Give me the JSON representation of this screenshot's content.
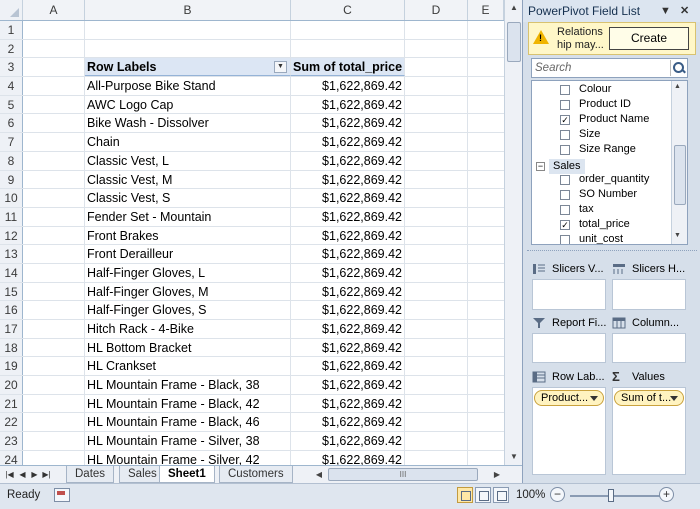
{
  "sheet": {
    "columns": [
      "A",
      "B",
      "C",
      "D",
      "E"
    ],
    "rows": [
      {
        "num": "1",
        "label": "",
        "value": ""
      },
      {
        "num": "2",
        "label": "",
        "value": ""
      },
      {
        "num": "3",
        "label": "Row Labels",
        "value": "Sum of total_price",
        "header": true
      },
      {
        "num": "4",
        "label": "All-Purpose Bike Stand",
        "value": "$1,622,869.42"
      },
      {
        "num": "5",
        "label": "AWC Logo Cap",
        "value": "$1,622,869.42"
      },
      {
        "num": "6",
        "label": "Bike Wash - Dissolver",
        "value": "$1,622,869.42"
      },
      {
        "num": "7",
        "label": "Chain",
        "value": "$1,622,869.42"
      },
      {
        "num": "8",
        "label": "Classic Vest, L",
        "value": "$1,622,869.42"
      },
      {
        "num": "9",
        "label": "Classic Vest, M",
        "value": "$1,622,869.42"
      },
      {
        "num": "10",
        "label": "Classic Vest, S",
        "value": "$1,622,869.42"
      },
      {
        "num": "11",
        "label": "Fender Set - Mountain",
        "value": "$1,622,869.42"
      },
      {
        "num": "12",
        "label": "Front Brakes",
        "value": "$1,622,869.42"
      },
      {
        "num": "13",
        "label": "Front Derailleur",
        "value": "$1,622,869.42"
      },
      {
        "num": "14",
        "label": "Half-Finger Gloves, L",
        "value": "$1,622,869.42"
      },
      {
        "num": "15",
        "label": "Half-Finger Gloves, M",
        "value": "$1,622,869.42"
      },
      {
        "num": "16",
        "label": "Half-Finger Gloves, S",
        "value": "$1,622,869.42"
      },
      {
        "num": "17",
        "label": "Hitch Rack - 4-Bike",
        "value": "$1,622,869.42"
      },
      {
        "num": "18",
        "label": "HL Bottom Bracket",
        "value": "$1,622,869.42"
      },
      {
        "num": "19",
        "label": "HL Crankset",
        "value": "$1,622,869.42"
      },
      {
        "num": "20",
        "label": "HL Mountain Frame - Black, 38",
        "value": "$1,622,869.42"
      },
      {
        "num": "21",
        "label": "HL Mountain Frame - Black, 42",
        "value": "$1,622,869.42"
      },
      {
        "num": "22",
        "label": "HL Mountain Frame - Black, 46",
        "value": "$1,622,869.42"
      },
      {
        "num": "23",
        "label": "HL Mountain Frame - Silver, 38",
        "value": "$1,622,869.42"
      },
      {
        "num": "24",
        "label": "HL Mountain Frame - Silver, 42",
        "value": "$1,622,869.42"
      }
    ],
    "tabs": [
      "Dates",
      "Sales",
      "Sheet1",
      "Customers"
    ],
    "active_tab": "Sheet1",
    "hscroll_grip": "III"
  },
  "status": {
    "ready": "Ready",
    "zoom": "100%",
    "zoom_minus": "−",
    "zoom_plus": "+"
  },
  "panel": {
    "title": "PowerPivot Field List",
    "notice_text": "Relations hip may...",
    "create_label": "Create",
    "search_placeholder": "Search",
    "fields": [
      {
        "label": "Colour",
        "checked": false
      },
      {
        "label": "Product ID",
        "checked": false
      },
      {
        "label": "Product Name",
        "checked": true
      },
      {
        "label": "Size",
        "checked": false
      },
      {
        "label": "Size Range",
        "checked": false
      }
    ],
    "group": {
      "label": "Sales",
      "toggle": "−"
    },
    "group_fields": [
      {
        "label": "order_quantity",
        "checked": false
      },
      {
        "label": "SO Number",
        "checked": false
      },
      {
        "label": "tax",
        "checked": false
      },
      {
        "label": "total_price",
        "checked": true
      },
      {
        "label": "unit_cost",
        "checked": false
      }
    ],
    "areas": {
      "slicers_v": "Slicers V...",
      "slicers_h": "Slicers H...",
      "report_filter": "Report Fi...",
      "columns": "Column...",
      "row_labels": "Row Lab...",
      "values": "Values",
      "row_pill": "Product...",
      "values_pill": "Sum of t..."
    }
  },
  "colors": {
    "header_fill": "#dce6f4",
    "pill_fill": "#fff3c0",
    "notice_fill": "#fff7c8",
    "panel_bg": "#d6dfea"
  }
}
